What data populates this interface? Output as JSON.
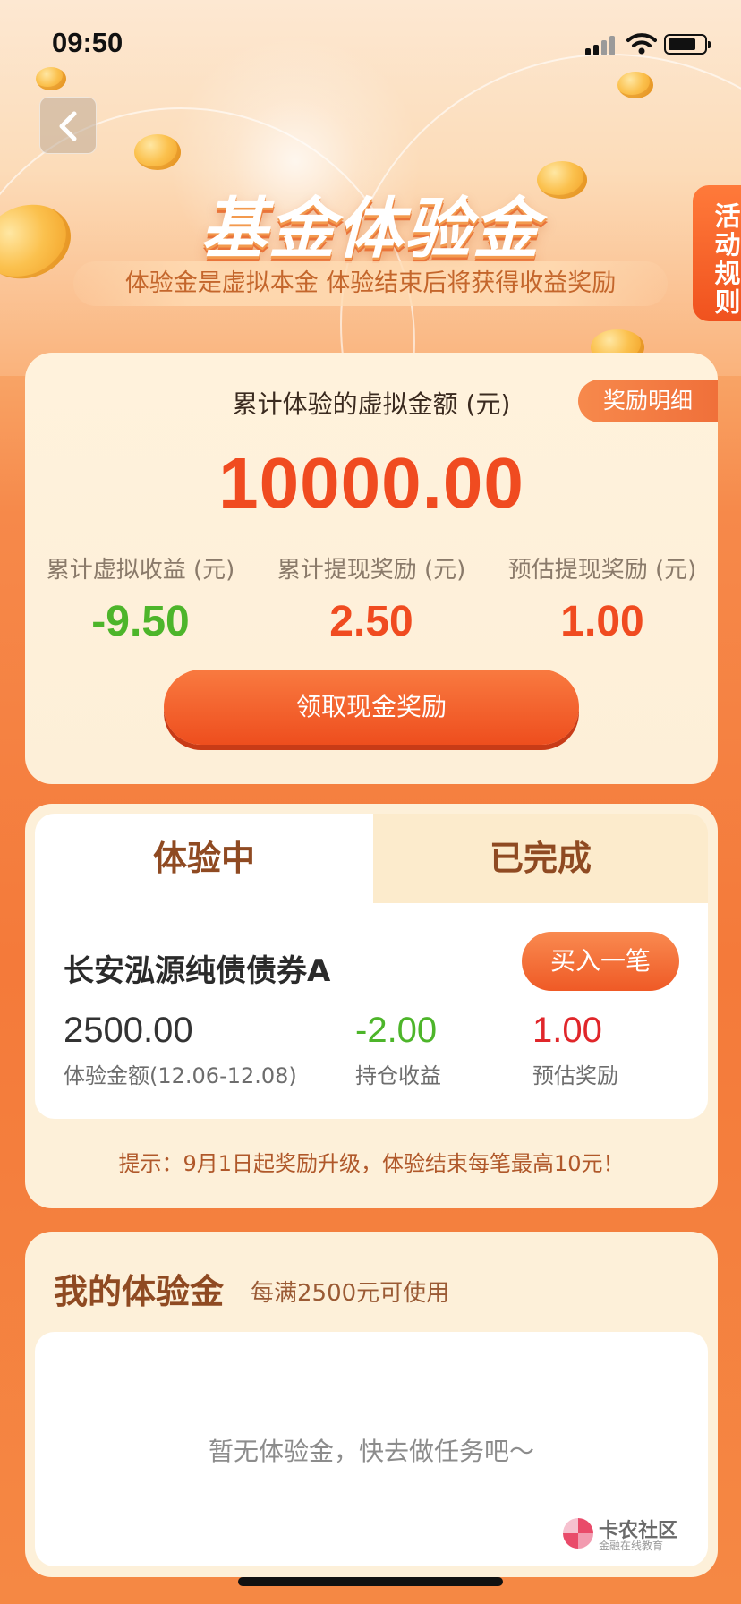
{
  "status_bar": {
    "time": "09:50"
  },
  "header": {
    "title": "基金体验金",
    "subtitle": "体验金是虚拟本金 体验结束后将获得收益奖励",
    "rules_tab": "活动规则"
  },
  "summary": {
    "label": "累计体验的虚拟金额 (元)",
    "detail_button": "奖励明细",
    "amount": "10000.00",
    "stats": [
      {
        "label": "累计虚拟收益 (元)",
        "value": "-9.50"
      },
      {
        "label": "累计提现奖励 (元)",
        "value": "2.50"
      },
      {
        "label": "预估提现奖励 (元)",
        "value": "1.00"
      }
    ],
    "claim_button": "领取现金奖励"
  },
  "experience": {
    "tabs": [
      "体验中",
      "已完成"
    ],
    "fund_name": "长安泓源纯债债券A",
    "buy_button": "买入一笔",
    "columns": [
      {
        "value": "2500.00",
        "label": "体验金额(12.06-12.08)"
      },
      {
        "value": "-2.00",
        "label": "持仓收益"
      },
      {
        "value": "1.00",
        "label": "预估奖励"
      }
    ],
    "tip": "提示：9月1日起奖励升级，体验结束每笔最高10元！"
  },
  "my_funds": {
    "title": "我的体验金",
    "subtitle": "每满2500元可使用",
    "empty_text": "暂无体验金，快去做任务吧～"
  },
  "watermark": {
    "name": "卡农社区",
    "sub": "金融在线教育"
  },
  "colors": {
    "accent": "#f04b20",
    "positive": "#4db52a",
    "brown": "#8f4a22"
  }
}
